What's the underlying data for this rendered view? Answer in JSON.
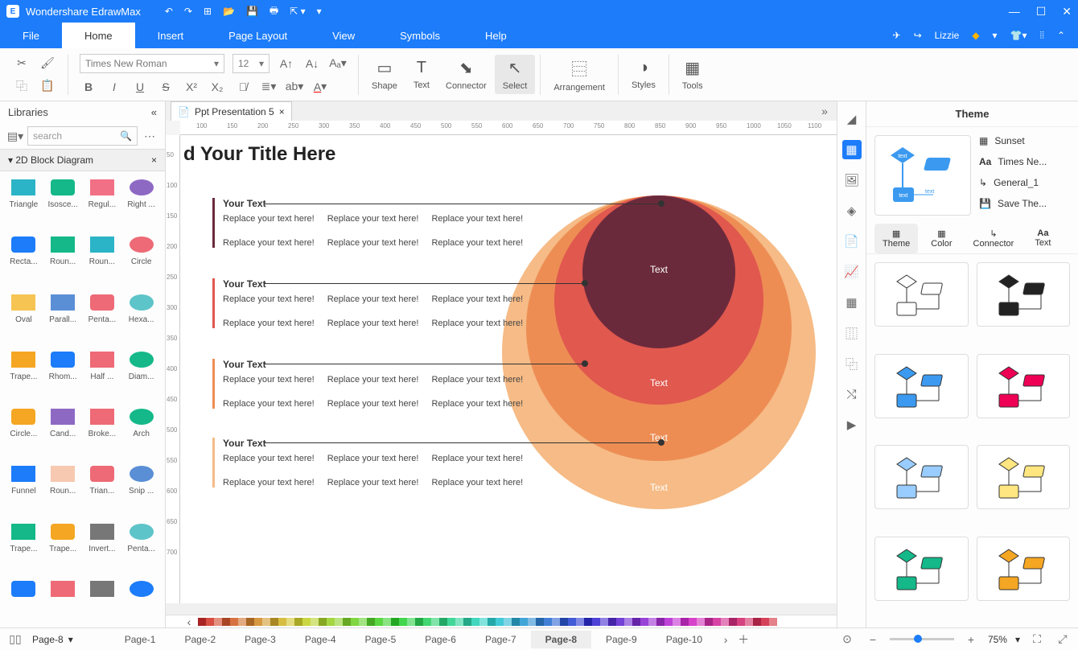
{
  "app": {
    "title": "Wondershare EdrawMax"
  },
  "menus": {
    "file": "File",
    "home": "Home",
    "insert": "Insert",
    "page_layout": "Page Layout",
    "view": "View",
    "symbols": "Symbols",
    "help": "Help"
  },
  "user": {
    "name": "Lizzie"
  },
  "ribbon": {
    "font_name": "Times New Roman",
    "font_size": "12",
    "shape": "Shape",
    "text": "Text",
    "connector": "Connector",
    "select": "Select",
    "arrangement": "Arrangement",
    "styles": "Styles",
    "tools": "Tools"
  },
  "libraries": {
    "title": "Libraries",
    "search_placeholder": "search",
    "category": "2D Block Diagram",
    "shapes": [
      "Triangle",
      "Isosce...",
      "Regul...",
      "Right ...",
      "Recta...",
      "Roun...",
      "Roun...",
      "Circle",
      "Oval",
      "Parall...",
      "Penta...",
      "Hexa...",
      "Trape...",
      "Rhom...",
      "Half ...",
      "Diam...",
      "Circle...",
      "Cand...",
      "Broke...",
      "Arch",
      "Funnel",
      "Roun...",
      "Trian...",
      "Snip ...",
      "Trape...",
      "Trape...",
      "Invert...",
      "Penta...",
      "",
      "",
      "",
      ""
    ]
  },
  "document": {
    "tab_name": "Ppt Presentation 5"
  },
  "canvas": {
    "title": "d Your Title Here",
    "circle_labels": [
      "Text",
      "Text",
      "Text",
      "Text"
    ],
    "blocks": [
      {
        "header": "Your Text",
        "color": "#6b2a3c"
      },
      {
        "header": "Your Text",
        "color": "#e0584e"
      },
      {
        "header": "Your Text",
        "color": "#ed8d54"
      },
      {
        "header": "Your Text",
        "color": "#f6bb86"
      }
    ],
    "replace_text": "Replace your text here!"
  },
  "ruler_h": [
    "100",
    "150",
    "200",
    "250",
    "300",
    "350",
    "400",
    "450",
    "500",
    "550",
    "600",
    "650",
    "700",
    "750",
    "800",
    "850",
    "900",
    "950",
    "1000",
    "1050",
    "1100"
  ],
  "ruler_v": [
    "50",
    "100",
    "150",
    "200",
    "250",
    "300",
    "350",
    "400",
    "450",
    "500",
    "550",
    "600",
    "650",
    "700"
  ],
  "theme": {
    "title": "Theme",
    "props": {
      "sunset": "Sunset",
      "font": "Times Ne...",
      "connector": "General_1",
      "save": "Save The..."
    },
    "tabs": {
      "theme": "Theme",
      "color": "Color",
      "connector": "Connector",
      "text": "Text"
    }
  },
  "pages": {
    "current": "Page-8",
    "list": [
      "Page-1",
      "Page-2",
      "Page-3",
      "Page-4",
      "Page-5",
      "Page-6",
      "Page-7",
      "Page-8",
      "Page-9",
      "Page-10"
    ]
  },
  "zoom": "75%"
}
